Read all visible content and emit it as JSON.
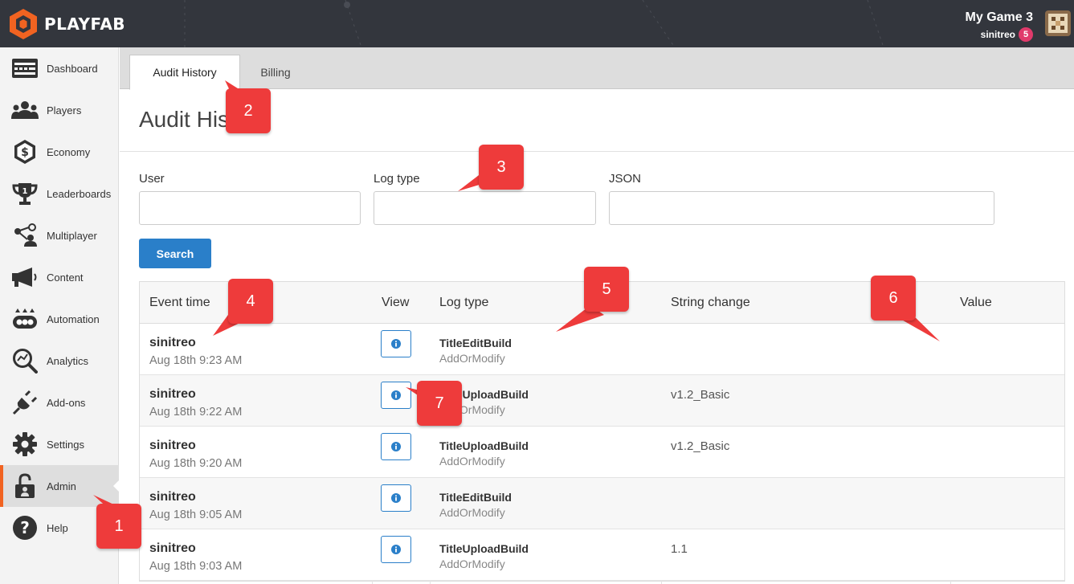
{
  "app": {
    "brand": "PLAYFAB",
    "game_name": "My Game 3",
    "username": "sinitreo",
    "notification_count": "5",
    "accent_color": "#f16321",
    "primary_color": "#2a7fc9",
    "callout_color": "#ee3b3b"
  },
  "sidebar": {
    "items": [
      {
        "label": "Dashboard",
        "icon": "dashboard-icon"
      },
      {
        "label": "Players",
        "icon": "players-icon"
      },
      {
        "label": "Economy",
        "icon": "economy-icon"
      },
      {
        "label": "Leaderboards",
        "icon": "trophy-icon"
      },
      {
        "label": "Multiplayer",
        "icon": "multiplayer-icon"
      },
      {
        "label": "Content",
        "icon": "megaphone-icon"
      },
      {
        "label": "Automation",
        "icon": "automation-icon"
      },
      {
        "label": "Analytics",
        "icon": "analytics-icon"
      },
      {
        "label": "Add-ons",
        "icon": "plug-icon"
      },
      {
        "label": "Settings",
        "icon": "gear-icon"
      },
      {
        "label": "Admin",
        "icon": "lock-icon",
        "active": true
      },
      {
        "label": "Help",
        "icon": "help-icon"
      }
    ]
  },
  "tabs": [
    {
      "label": "Audit History",
      "active": true
    },
    {
      "label": "Billing",
      "active": false
    }
  ],
  "page": {
    "title": "Audit History"
  },
  "filters": {
    "user_label": "User",
    "user_value": "",
    "logtype_label": "Log type",
    "logtype_value": "",
    "json_label": "JSON",
    "json_value": "",
    "search_label": "Search"
  },
  "table": {
    "headers": [
      "Event time",
      "View",
      "Log type",
      "String change",
      "Value"
    ],
    "rows": [
      {
        "user": "sinitreo",
        "time": "Aug 18th 9:23 AM",
        "log_type": "TitleEditBuild",
        "operation": "AddOrModify",
        "string_change": "",
        "value": ""
      },
      {
        "user": "sinitreo",
        "time": "Aug 18th 9:22 AM",
        "log_type": "TitleUploadBuild",
        "operation": "AddOrModify",
        "string_change": "v1.2_Basic",
        "value": ""
      },
      {
        "user": "sinitreo",
        "time": "Aug 18th 9:20 AM",
        "log_type": "TitleUploadBuild",
        "operation": "AddOrModify",
        "string_change": "v1.2_Basic",
        "value": ""
      },
      {
        "user": "sinitreo",
        "time": "Aug 18th 9:05 AM",
        "log_type": "TitleEditBuild",
        "operation": "AddOrModify",
        "string_change": "",
        "value": ""
      },
      {
        "user": "sinitreo",
        "time": "Aug 18th 9:03 AM",
        "log_type": "TitleUploadBuild",
        "operation": "AddOrModify",
        "string_change": "1.1",
        "value": ""
      }
    ]
  },
  "callouts": [
    "1",
    "2",
    "3",
    "4",
    "5",
    "6",
    "7"
  ]
}
